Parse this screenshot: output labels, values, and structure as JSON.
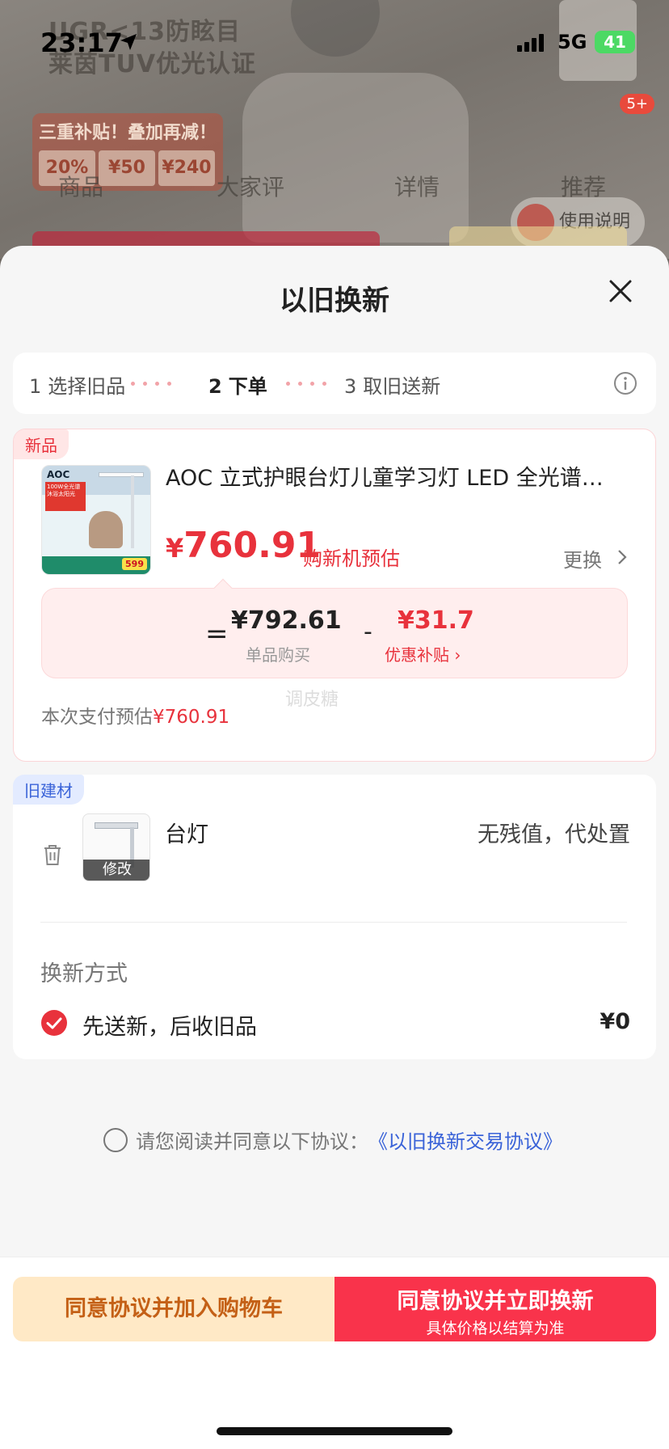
{
  "status_bar": {
    "time": "23:17",
    "network": "5G",
    "battery": "41"
  },
  "background": {
    "title_line1": "UGR<13防眩目",
    "title_line2": "莱茵TUV优光认证",
    "promo_title": "三重补贴！叠加再减！",
    "promo_cells": [
      "20%",
      "¥50",
      "¥240"
    ],
    "tabs": [
      "商品",
      "大家评",
      "详情",
      "推荐"
    ],
    "manual_label": "使用说明",
    "cart_badge": "5+"
  },
  "sheet": {
    "title": "以旧换新"
  },
  "steps": [
    {
      "num": "1",
      "label": "选择旧品"
    },
    {
      "num": "2",
      "label": "下单"
    },
    {
      "num": "3",
      "label": "取旧送新"
    }
  ],
  "new_product": {
    "tag": "新品",
    "thumb_logo": "AOC",
    "thumb_banner": "100W全光谱 沐浴太阳光",
    "thumb_price": "599",
    "name": "AOC 立式护眼台灯儿童学习灯 LED 全光谱…",
    "price_symbol": "¥",
    "price": "760.91",
    "price_note": "购新机预估",
    "replace_label": "更换",
    "calc": {
      "equals": "=",
      "unit_price": "¥792.61",
      "unit_price_label": "单品购买",
      "minus": "-",
      "discount": "¥31.7",
      "discount_label": "优惠补贴 ›"
    },
    "watermark": "调皮糖",
    "pay_estimate_label": "本次支付预估",
    "pay_estimate_amount": "¥760.91"
  },
  "old_item": {
    "tag": "旧建材",
    "edit_label": "修改",
    "name": "台灯",
    "value": "无残值，代处置",
    "method_title": "换新方式",
    "method_label": "先送新，后收旧品",
    "method_price": "¥0"
  },
  "agreement": {
    "text": "请您阅读并同意以下协议：",
    "link": "《以旧换新交易协议》"
  },
  "footer": {
    "cart_button": "同意协议并加入购物车",
    "now_button": "同意协议并立即换新",
    "now_button_sub": "具体价格以结算为准"
  },
  "colors": {
    "accent_red": "#e8323c",
    "button_red": "#f9334b",
    "button_cream": "#ffe9c6",
    "link_blue": "#3a63d8"
  }
}
